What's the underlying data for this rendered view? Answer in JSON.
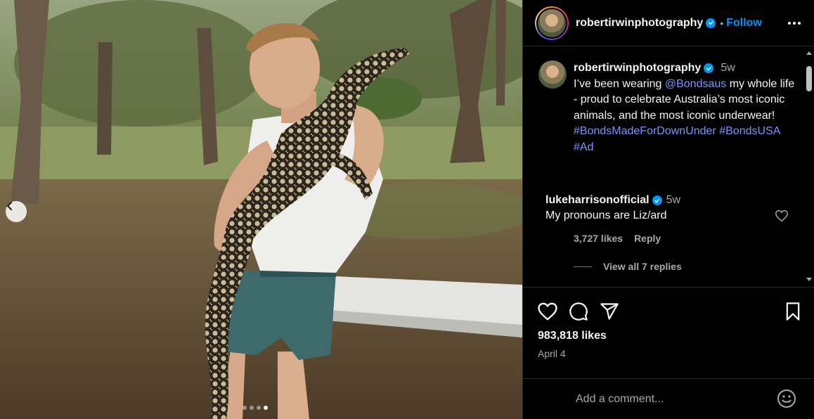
{
  "post": {
    "author": "robertirwinphotography",
    "follow_label": "Follow",
    "separator": "•",
    "caption": {
      "author": "robertirwinphotography",
      "age": "5w",
      "text_before": "I’ve been wearing ",
      "mention": "@Bondsaus",
      "text_after": " my whole life - proud to celebrate Australia’s most iconic animals, and the most iconic underwear! ",
      "hashtags": [
        "#BondsMadeForDownUnder",
        "#BondsUSA",
        "#Ad"
      ]
    },
    "comments": [
      {
        "author": "lukeharrisonofficial",
        "age": "5w",
        "text": "My pronouns are Liz/ard",
        "likes": "3,727 likes",
        "reply_label": "Reply",
        "view_replies": "View all 7 replies"
      }
    ],
    "likes": "983,818 likes",
    "date": "April 4",
    "comment_placeholder": "Add a comment...",
    "carousel": {
      "slides": 4,
      "active": 4
    },
    "underwear_brand": "BONDS"
  },
  "icons": {
    "prev": "chevron-left-icon",
    "more": "more-horizontal-icon",
    "verified": "verified-badge-icon",
    "like": "heart-icon",
    "comment": "comment-bubble-icon",
    "share": "paper-plane-icon",
    "save": "bookmark-icon",
    "emoji": "smiley-icon"
  },
  "colors": {
    "accent": "#0095f6",
    "link": "#7a96ff",
    "muted": "#a8a8a8",
    "background": "#000000"
  }
}
